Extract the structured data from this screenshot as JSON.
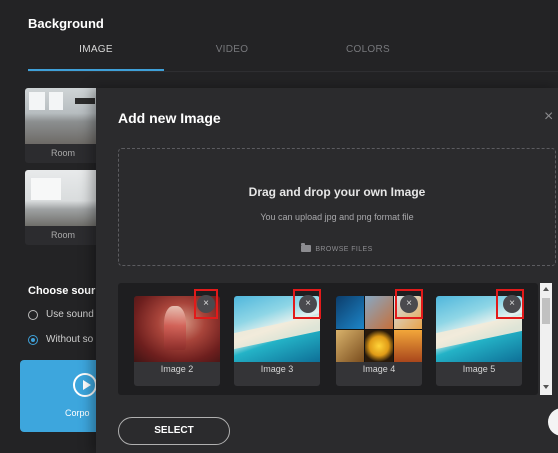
{
  "background": {
    "title": "Background",
    "tabs": [
      {
        "label": "IMAGE",
        "active": true
      },
      {
        "label": "VIDEO",
        "active": false
      },
      {
        "label": "COLORS",
        "active": false
      }
    ],
    "rooms": [
      {
        "label": "Room"
      },
      {
        "label": "Room"
      }
    ],
    "choose_sound": {
      "title": "Choose sour",
      "options": [
        {
          "label": "Use sound",
          "selected": false
        },
        {
          "label": "Without so",
          "selected": true
        }
      ]
    },
    "video_card": {
      "label": "Corpo"
    }
  },
  "modal": {
    "title": "Add new Image",
    "close_icon": "×",
    "dropzone": {
      "title": "Drag and drop your own Image",
      "subtitle": "You can upload jpg and png format file",
      "browse_label": "BROWSE FILES"
    },
    "images": [
      {
        "label": "Image 2",
        "kind": "red-figure"
      },
      {
        "label": "Image 3",
        "kind": "beach"
      },
      {
        "label": "Image 4",
        "kind": "collage"
      },
      {
        "label": "Image 5",
        "kind": "beach"
      }
    ],
    "remove_icon": "×",
    "select_label": "SELECT"
  },
  "colors": {
    "accent": "#3fa0d8",
    "highlight": "#e21a1a"
  }
}
